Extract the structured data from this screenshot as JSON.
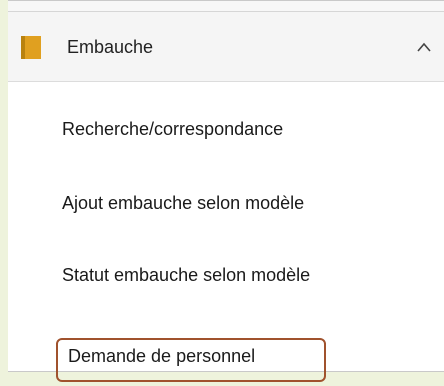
{
  "menu": {
    "header": {
      "label": "Embauche",
      "icon": "folder-icon",
      "toggle_icon": "chevron-up-icon",
      "expanded": true
    },
    "items": [
      {
        "label": "Recherche/correspondance"
      },
      {
        "label": "Ajout embauche selon modèle"
      },
      {
        "label": "Statut embauche selon modèle"
      },
      {
        "label": "Demande de personnel",
        "highlighted": true
      }
    ]
  },
  "colors": {
    "background": "#eef3dc",
    "folder": "#e0a020",
    "highlight_border": "#a0522d"
  }
}
